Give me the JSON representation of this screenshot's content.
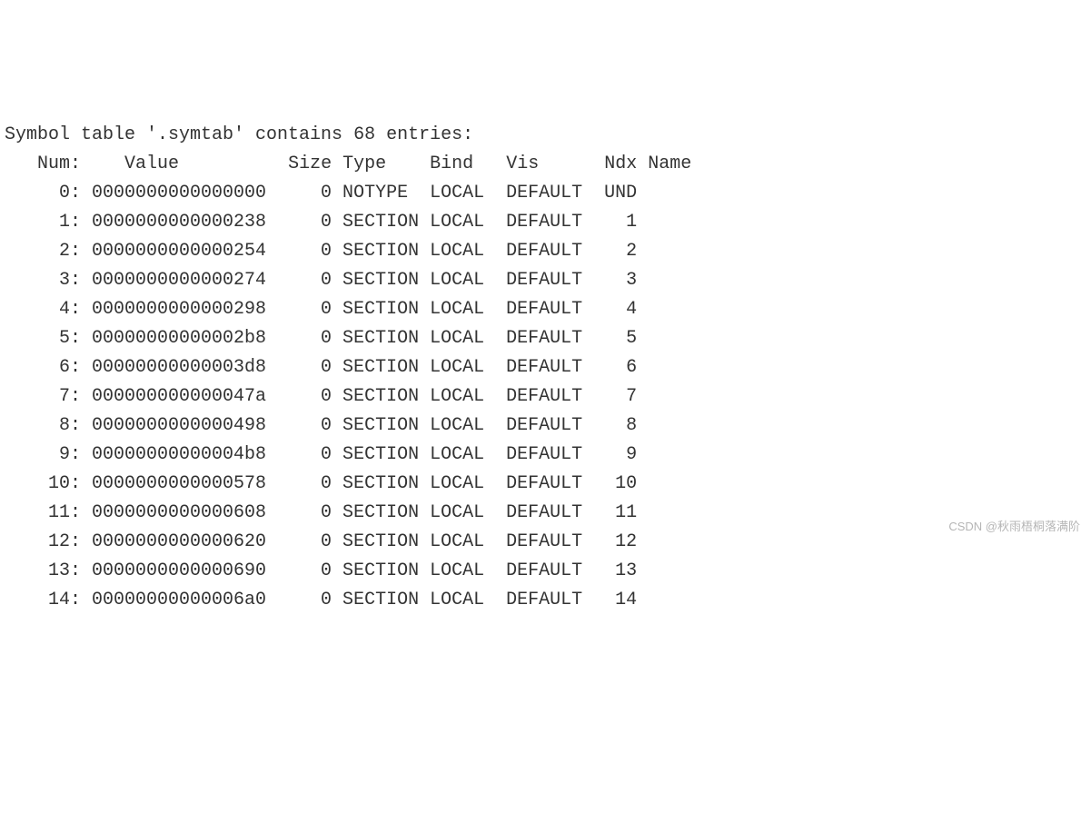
{
  "title": "Symbol table '.symtab' contains 68 entries:",
  "headers": {
    "num": "Num:",
    "value": "Value",
    "size": "Size",
    "type": "Type",
    "bind": "Bind",
    "vis": "Vis",
    "ndx": "Ndx",
    "name": "Name"
  },
  "rows": [
    {
      "num": "0:",
      "value": "0000000000000000",
      "size": "0",
      "type": "NOTYPE",
      "bind": "LOCAL",
      "vis": "DEFAULT",
      "ndx": "UND",
      "name": ""
    },
    {
      "num": "1:",
      "value": "0000000000000238",
      "size": "0",
      "type": "SECTION",
      "bind": "LOCAL",
      "vis": "DEFAULT",
      "ndx": "1",
      "name": ""
    },
    {
      "num": "2:",
      "value": "0000000000000254",
      "size": "0",
      "type": "SECTION",
      "bind": "LOCAL",
      "vis": "DEFAULT",
      "ndx": "2",
      "name": ""
    },
    {
      "num": "3:",
      "value": "0000000000000274",
      "size": "0",
      "type": "SECTION",
      "bind": "LOCAL",
      "vis": "DEFAULT",
      "ndx": "3",
      "name": ""
    },
    {
      "num": "4:",
      "value": "0000000000000298",
      "size": "0",
      "type": "SECTION",
      "bind": "LOCAL",
      "vis": "DEFAULT",
      "ndx": "4",
      "name": ""
    },
    {
      "num": "5:",
      "value": "00000000000002b8",
      "size": "0",
      "type": "SECTION",
      "bind": "LOCAL",
      "vis": "DEFAULT",
      "ndx": "5",
      "name": ""
    },
    {
      "num": "6:",
      "value": "00000000000003d8",
      "size": "0",
      "type": "SECTION",
      "bind": "LOCAL",
      "vis": "DEFAULT",
      "ndx": "6",
      "name": ""
    },
    {
      "num": "7:",
      "value": "000000000000047a",
      "size": "0",
      "type": "SECTION",
      "bind": "LOCAL",
      "vis": "DEFAULT",
      "ndx": "7",
      "name": ""
    },
    {
      "num": "8:",
      "value": "0000000000000498",
      "size": "0",
      "type": "SECTION",
      "bind": "LOCAL",
      "vis": "DEFAULT",
      "ndx": "8",
      "name": ""
    },
    {
      "num": "9:",
      "value": "00000000000004b8",
      "size": "0",
      "type": "SECTION",
      "bind": "LOCAL",
      "vis": "DEFAULT",
      "ndx": "9",
      "name": ""
    },
    {
      "num": "10:",
      "value": "0000000000000578",
      "size": "0",
      "type": "SECTION",
      "bind": "LOCAL",
      "vis": "DEFAULT",
      "ndx": "10",
      "name": ""
    },
    {
      "num": "11:",
      "value": "0000000000000608",
      "size": "0",
      "type": "SECTION",
      "bind": "LOCAL",
      "vis": "DEFAULT",
      "ndx": "11",
      "name": ""
    },
    {
      "num": "12:",
      "value": "0000000000000620",
      "size": "0",
      "type": "SECTION",
      "bind": "LOCAL",
      "vis": "DEFAULT",
      "ndx": "12",
      "name": ""
    },
    {
      "num": "13:",
      "value": "0000000000000690",
      "size": "0",
      "type": "SECTION",
      "bind": "LOCAL",
      "vis": "DEFAULT",
      "ndx": "13",
      "name": ""
    },
    {
      "num": "14:",
      "value": "00000000000006a0",
      "size": "0",
      "type": "SECTION",
      "bind": "LOCAL",
      "vis": "DEFAULT",
      "ndx": "14",
      "name": ""
    }
  ],
  "watermark": "CSDN @秋雨梧桐落满阶"
}
